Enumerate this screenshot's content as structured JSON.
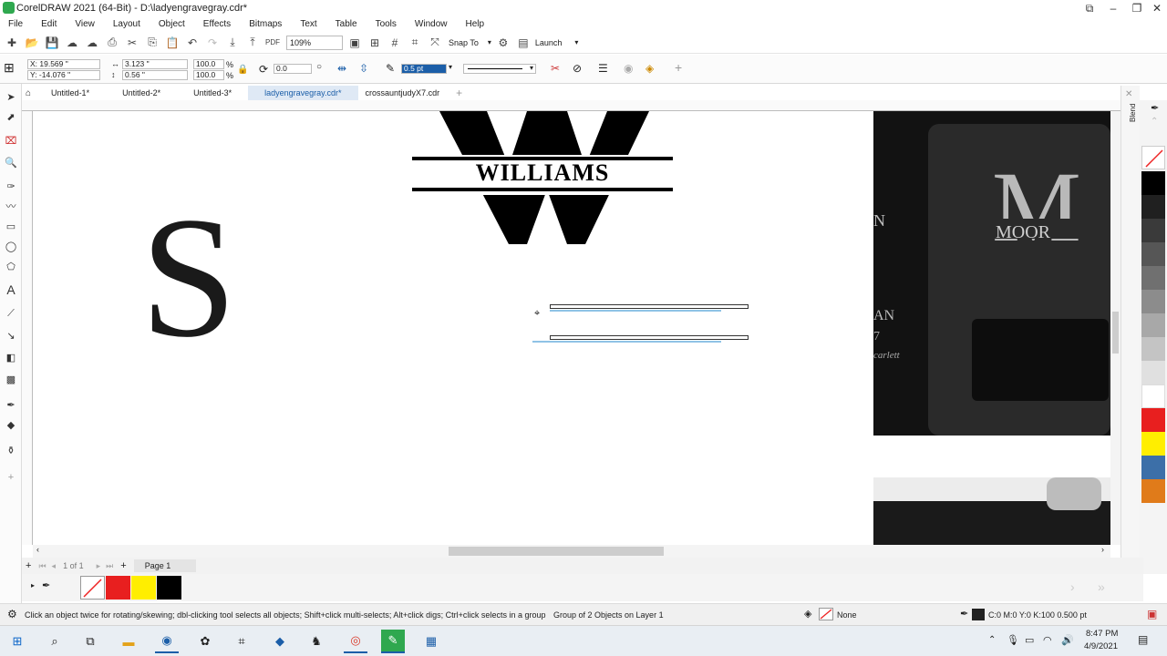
{
  "window": {
    "title": "CorelDRAW 2021 (64-Bit) - D:\\ladyengravegray.cdr*"
  },
  "menu": [
    "File",
    "Edit",
    "View",
    "Layout",
    "Object",
    "Effects",
    "Bitmaps",
    "Text",
    "Table",
    "Tools",
    "Window",
    "Help"
  ],
  "toolbar": {
    "zoom": "109%",
    "snap_to": "Snap To",
    "launch": "Launch"
  },
  "properties": {
    "x": "X: 19.569 \"",
    "y": "Y: -14.076 \"",
    "width": "3.123 \"",
    "height": "0.56 \"",
    "scale_w": "100.0",
    "scale_h": "100.0",
    "pct": "%",
    "rotation": "0.0",
    "outline_width": "0.5 pt"
  },
  "tabs": [
    "Untitled-1*",
    "Untitled-2*",
    "Untitled-3*",
    "ladyengravegray.cdr*",
    "crossauntjudyX7.cdr"
  ],
  "canvas": {
    "letter": "S",
    "name_text": "WILLIAMS",
    "photo_text1": "MOOR",
    "photo_text2": "N",
    "photo_text3": "AN",
    "photo_text4": "7",
    "photo_text5": "carlett"
  },
  "pagebar": {
    "page_count": "1 of 1",
    "page_label": "Page 1"
  },
  "status": {
    "hint": "Click an object twice for rotating/skewing; dbl-clicking tool selects all objects; Shift+click multi-selects; Alt+click digs; Ctrl+click selects in a group",
    "selection": "Group of 2 Objects on Layer 1",
    "fill": "None",
    "outline": "C:0 M:0 Y:0 K:100  0.500 pt"
  },
  "taskbar": {
    "time": "8:47 PM",
    "date": "4/9/2021"
  },
  "docker": {
    "blend_label": "Blend"
  },
  "colors": {
    "palette": [
      "#000000",
      "#202020",
      "#3a3a3a",
      "#565656",
      "#707070",
      "#8c8c8c",
      "#a8a8a8",
      "#c4c4c4",
      "#e0e0e0",
      "#ffffff",
      "#e81f1f",
      "#ffee00",
      "#3c6fa8",
      "#e07b1a"
    ],
    "doc_palette": [
      "#e81f1f",
      "#ffee00",
      "#000000"
    ],
    "accent": "#1b5ea8"
  }
}
